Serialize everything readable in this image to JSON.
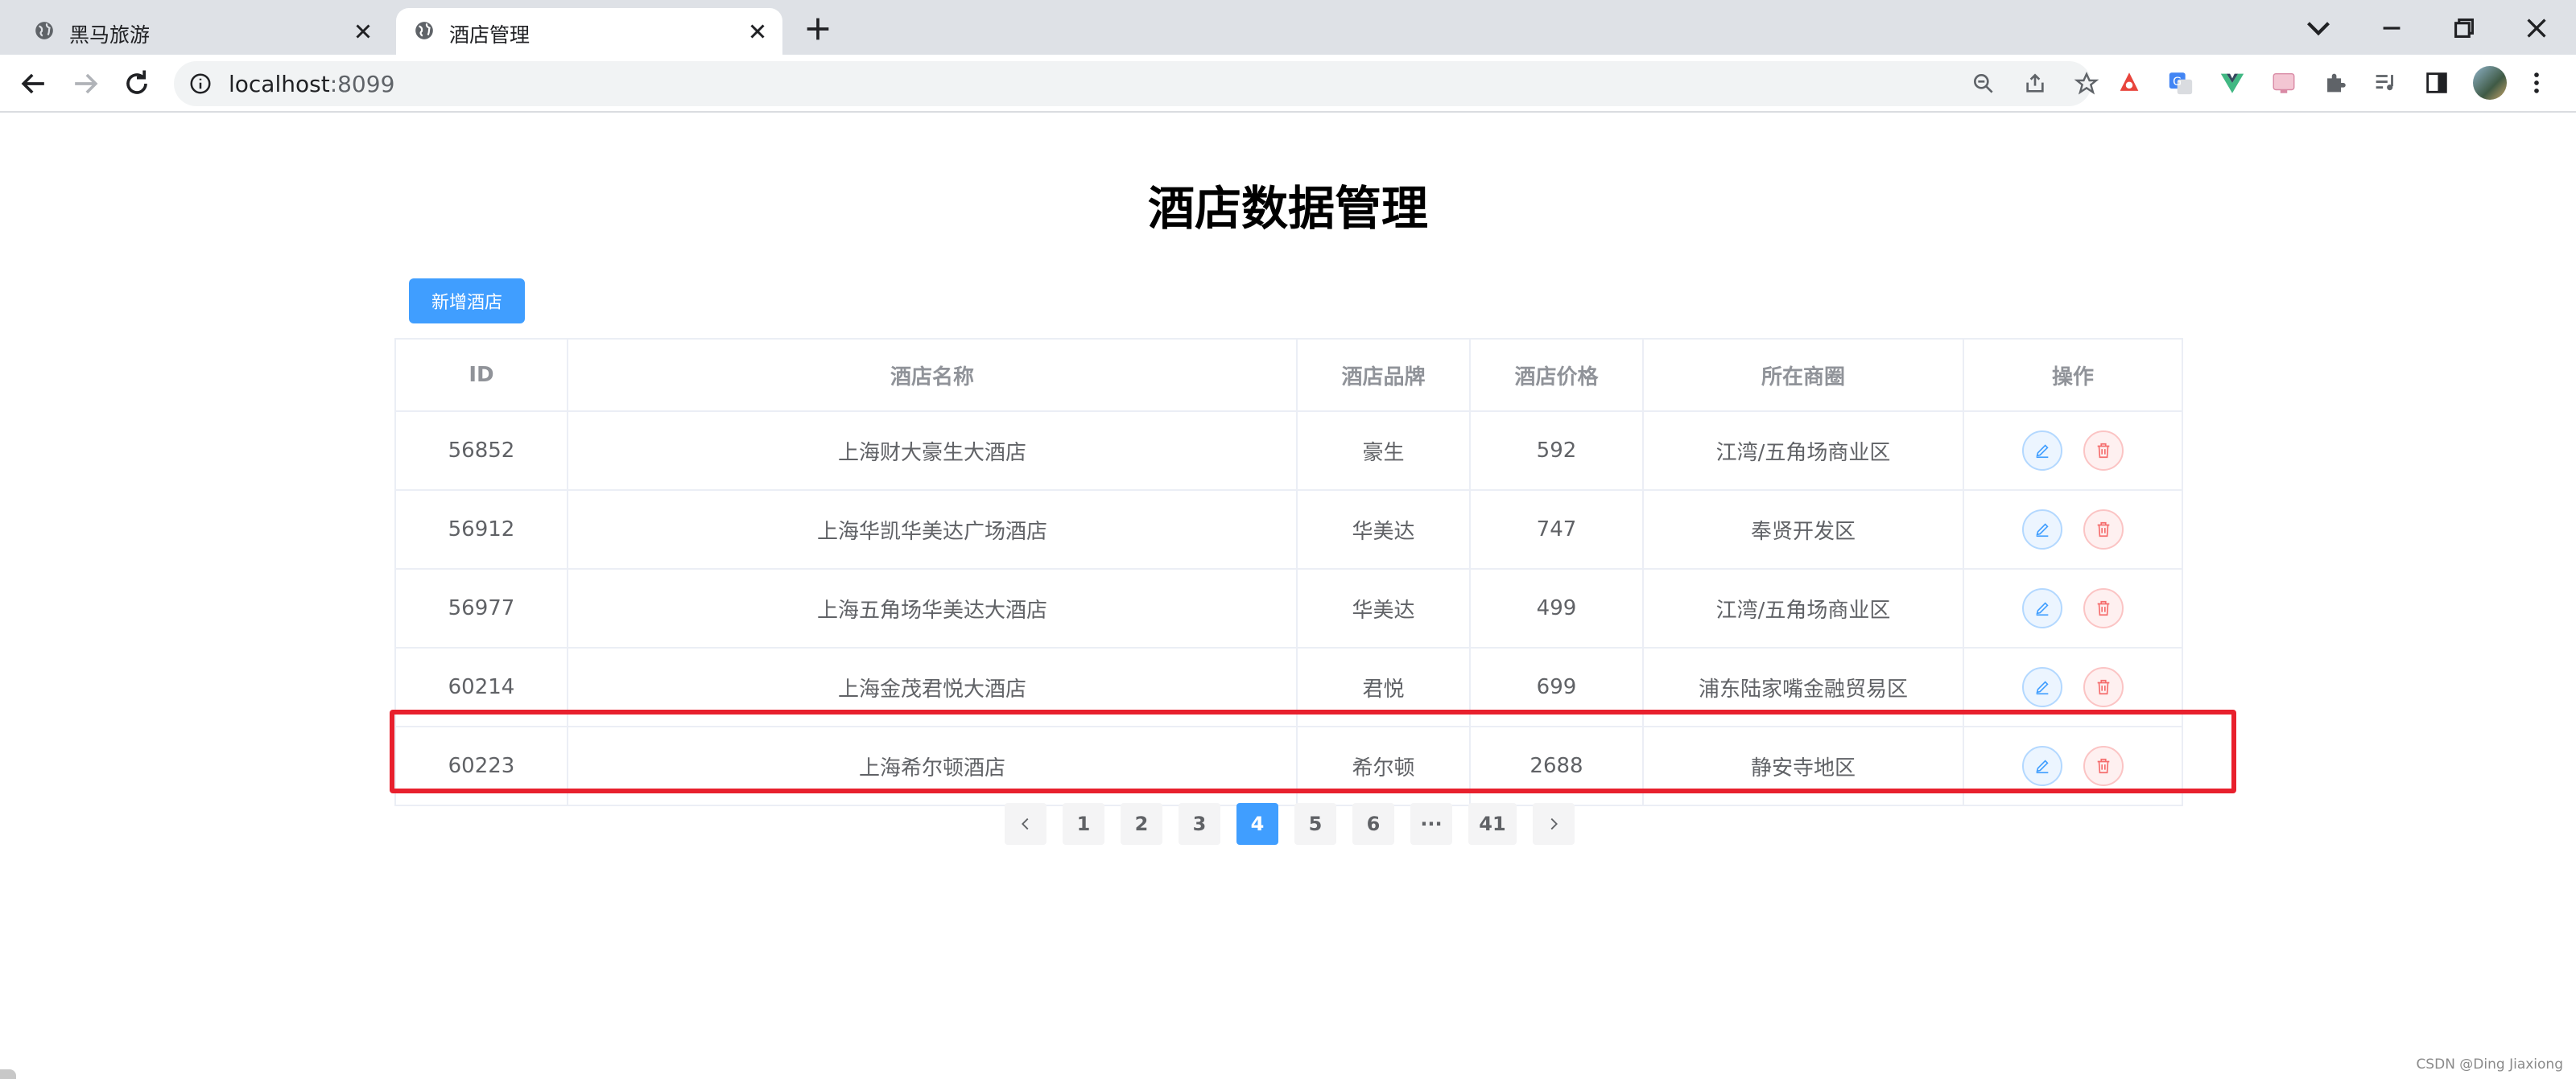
{
  "browser": {
    "tabs": [
      {
        "title": "黑马旅游",
        "active": false
      },
      {
        "title": "酒店管理",
        "active": true
      }
    ],
    "url_host": "localhost",
    "url_port": ":8099"
  },
  "page": {
    "title": "酒店数据管理",
    "add_button": "新增酒店"
  },
  "table": {
    "columns": [
      "ID",
      "酒店名称",
      "酒店品牌",
      "酒店价格",
      "所在商圈",
      "操作"
    ],
    "rows": [
      {
        "id": "56852",
        "name": "上海财大豪生大酒店",
        "brand": "豪生",
        "price": "592",
        "area": "江湾/五角场商业区"
      },
      {
        "id": "56912",
        "name": "上海华凯华美达广场酒店",
        "brand": "华美达",
        "price": "747",
        "area": "奉贤开发区"
      },
      {
        "id": "56977",
        "name": "上海五角场华美达大酒店",
        "brand": "华美达",
        "price": "499",
        "area": "江湾/五角场商业区"
      },
      {
        "id": "60214",
        "name": "上海金茂君悦大酒店",
        "brand": "君悦",
        "price": "699",
        "area": "浦东陆家嘴金融贸易区"
      },
      {
        "id": "60223",
        "name": "上海希尔顿酒店",
        "brand": "希尔顿",
        "price": "2688",
        "area": "静安寺地区"
      }
    ]
  },
  "pagination": {
    "pages": [
      "1",
      "2",
      "3",
      "4",
      "5",
      "6"
    ],
    "current": "4",
    "ellipsis": "···",
    "last": "41"
  },
  "watermark": "CSDN @Ding Jiaxiong",
  "colors": {
    "primary": "#409eff",
    "highlight": "#e8202d",
    "danger": "#f56c6c"
  }
}
